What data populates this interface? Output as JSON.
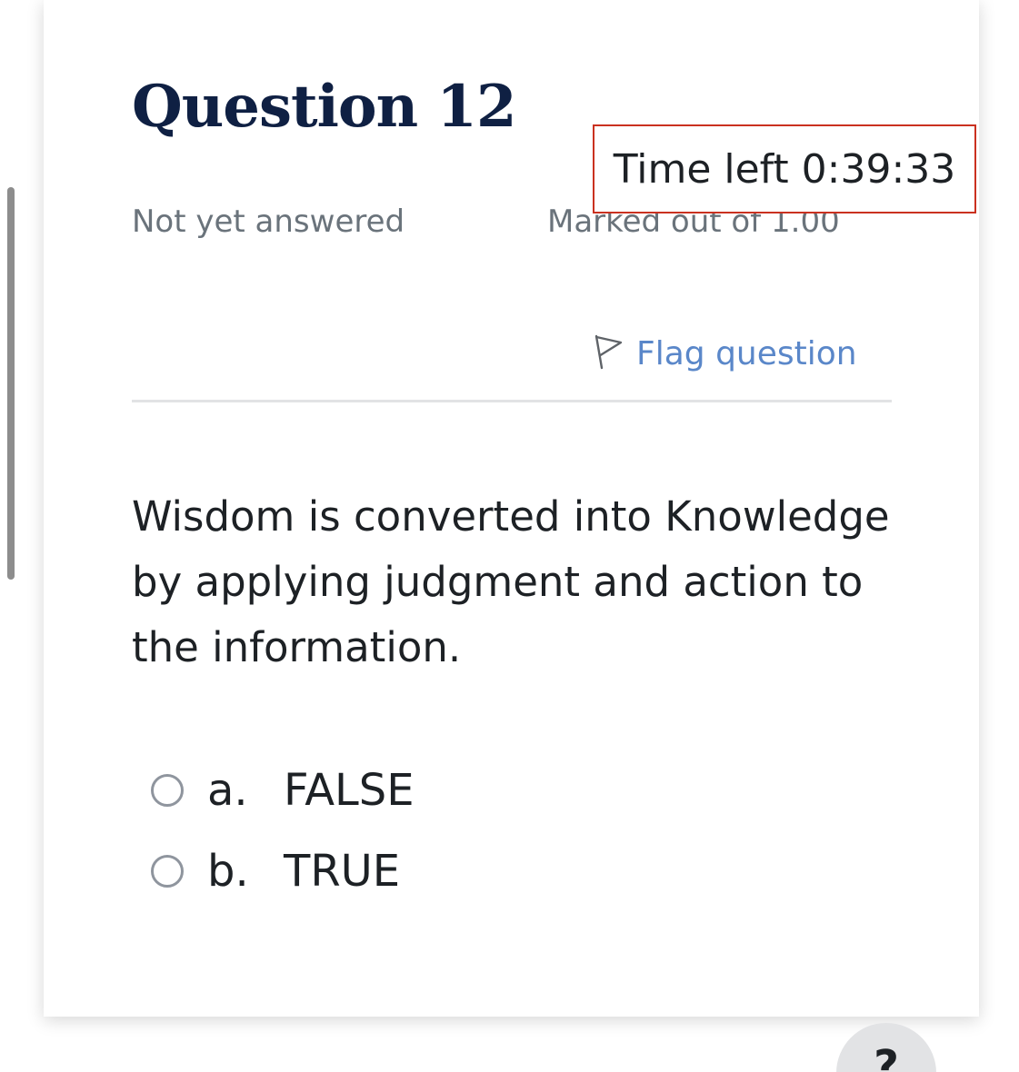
{
  "question": {
    "title": "Question 12",
    "status": "Not yet answered",
    "marked": "Marked out of 1.00",
    "flag_label": "Flag question",
    "text": "Wisdom is converted into Knowledge by applying judgment and action to the information."
  },
  "timer": {
    "label": "Time left 0:39:33"
  },
  "answers": [
    {
      "letter": "a.",
      "text": "FALSE",
      "selected": false
    },
    {
      "letter": "b.",
      "text": "TRUE",
      "selected": false
    }
  ],
  "help_button": {
    "label": "?"
  },
  "icons": {
    "flag": "flag-icon",
    "radio": "radio-icon"
  },
  "colors": {
    "title": "#0f2043",
    "timer_border": "#ca3120",
    "link": "#5a87c9",
    "muted": "#6a737b"
  }
}
